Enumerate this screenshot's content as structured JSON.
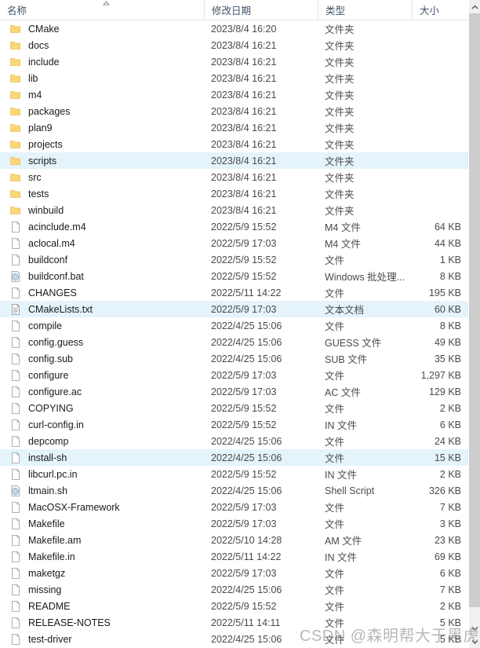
{
  "window": {
    "accent_selection_color": "#e5f3fb",
    "header_text_color": "#40556b"
  },
  "columns": {
    "name": "名称",
    "date_modified": "修改日期",
    "type": "类型",
    "size": "大小",
    "sort_indicator": "ascending"
  },
  "scrollbar": {
    "up_arrow": "^",
    "down_arrow": "v"
  },
  "watermark": {
    "text": "CSDN @森明帮大于黑虎帮"
  },
  "files": [
    {
      "name": "CMake",
      "date": "2023/8/4 16:20",
      "type": "文件夹",
      "size": "",
      "icon": "folder-icon",
      "selected": false
    },
    {
      "name": "docs",
      "date": "2023/8/4 16:21",
      "type": "文件夹",
      "size": "",
      "icon": "folder-icon",
      "selected": false
    },
    {
      "name": "include",
      "date": "2023/8/4 16:21",
      "type": "文件夹",
      "size": "",
      "icon": "folder-icon",
      "selected": false
    },
    {
      "name": "lib",
      "date": "2023/8/4 16:21",
      "type": "文件夹",
      "size": "",
      "icon": "folder-icon",
      "selected": false
    },
    {
      "name": "m4",
      "date": "2023/8/4 16:21",
      "type": "文件夹",
      "size": "",
      "icon": "folder-icon",
      "selected": false
    },
    {
      "name": "packages",
      "date": "2023/8/4 16:21",
      "type": "文件夹",
      "size": "",
      "icon": "folder-icon",
      "selected": false
    },
    {
      "name": "plan9",
      "date": "2023/8/4 16:21",
      "type": "文件夹",
      "size": "",
      "icon": "folder-icon",
      "selected": false
    },
    {
      "name": "projects",
      "date": "2023/8/4 16:21",
      "type": "文件夹",
      "size": "",
      "icon": "folder-icon",
      "selected": false
    },
    {
      "name": "scripts",
      "date": "2023/8/4 16:21",
      "type": "文件夹",
      "size": "",
      "icon": "folder-icon",
      "selected": true
    },
    {
      "name": "src",
      "date": "2023/8/4 16:21",
      "type": "文件夹",
      "size": "",
      "icon": "folder-icon",
      "selected": false
    },
    {
      "name": "tests",
      "date": "2023/8/4 16:21",
      "type": "文件夹",
      "size": "",
      "icon": "folder-icon",
      "selected": false
    },
    {
      "name": "winbuild",
      "date": "2023/8/4 16:21",
      "type": "文件夹",
      "size": "",
      "icon": "folder-icon",
      "selected": false
    },
    {
      "name": "acinclude.m4",
      "date": "2022/5/9 15:52",
      "type": "M4 文件",
      "size": "64 KB",
      "icon": "file-icon",
      "selected": false
    },
    {
      "name": "aclocal.m4",
      "date": "2022/5/9 17:03",
      "type": "M4 文件",
      "size": "44 KB",
      "icon": "file-icon",
      "selected": false
    },
    {
      "name": "buildconf",
      "date": "2022/5/9 15:52",
      "type": "文件",
      "size": "1 KB",
      "icon": "file-icon",
      "selected": false
    },
    {
      "name": "buildconf.bat",
      "date": "2022/5/9 15:52",
      "type": "Windows 批处理...",
      "size": "8 KB",
      "icon": "gear-file-icon",
      "selected": false
    },
    {
      "name": "CHANGES",
      "date": "2022/5/11 14:22",
      "type": "文件",
      "size": "195 KB",
      "icon": "file-icon",
      "selected": false
    },
    {
      "name": "CMakeLists.txt",
      "date": "2022/5/9 17:03",
      "type": "文本文档",
      "size": "60 KB",
      "icon": "text-file-icon",
      "selected": true
    },
    {
      "name": "compile",
      "date": "2022/4/25 15:06",
      "type": "文件",
      "size": "8 KB",
      "icon": "file-icon",
      "selected": false
    },
    {
      "name": "config.guess",
      "date": "2022/4/25 15:06",
      "type": "GUESS 文件",
      "size": "49 KB",
      "icon": "file-icon",
      "selected": false
    },
    {
      "name": "config.sub",
      "date": "2022/4/25 15:06",
      "type": "SUB 文件",
      "size": "35 KB",
      "icon": "file-icon",
      "selected": false
    },
    {
      "name": "configure",
      "date": "2022/5/9 17:03",
      "type": "文件",
      "size": "1,297 KB",
      "icon": "file-icon",
      "selected": false
    },
    {
      "name": "configure.ac",
      "date": "2022/5/9 17:03",
      "type": "AC 文件",
      "size": "129 KB",
      "icon": "file-icon",
      "selected": false
    },
    {
      "name": "COPYING",
      "date": "2022/5/9 15:52",
      "type": "文件",
      "size": "2 KB",
      "icon": "file-icon",
      "selected": false
    },
    {
      "name": "curl-config.in",
      "date": "2022/5/9 15:52",
      "type": "IN 文件",
      "size": "6 KB",
      "icon": "file-icon",
      "selected": false
    },
    {
      "name": "depcomp",
      "date": "2022/4/25 15:06",
      "type": "文件",
      "size": "24 KB",
      "icon": "file-icon",
      "selected": false
    },
    {
      "name": "install-sh",
      "date": "2022/4/25 15:06",
      "type": "文件",
      "size": "15 KB",
      "icon": "file-icon",
      "selected": true
    },
    {
      "name": "libcurl.pc.in",
      "date": "2022/5/9 15:52",
      "type": "IN 文件",
      "size": "2 KB",
      "icon": "file-icon",
      "selected": false
    },
    {
      "name": "ltmain.sh",
      "date": "2022/4/25 15:06",
      "type": "Shell Script",
      "size": "326 KB",
      "icon": "gear-file-icon",
      "selected": false
    },
    {
      "name": "MacOSX-Framework",
      "date": "2022/5/9 17:03",
      "type": "文件",
      "size": "7 KB",
      "icon": "file-icon",
      "selected": false
    },
    {
      "name": "Makefile",
      "date": "2022/5/9 17:03",
      "type": "文件",
      "size": "3 KB",
      "icon": "file-icon",
      "selected": false
    },
    {
      "name": "Makefile.am",
      "date": "2022/5/10 14:28",
      "type": "AM 文件",
      "size": "23 KB",
      "icon": "file-icon",
      "selected": false
    },
    {
      "name": "Makefile.in",
      "date": "2022/5/11 14:22",
      "type": "IN 文件",
      "size": "69 KB",
      "icon": "file-icon",
      "selected": false
    },
    {
      "name": "maketgz",
      "date": "2022/5/9 17:03",
      "type": "文件",
      "size": "6 KB",
      "icon": "file-icon",
      "selected": false
    },
    {
      "name": "missing",
      "date": "2022/4/25 15:06",
      "type": "文件",
      "size": "7 KB",
      "icon": "file-icon",
      "selected": false
    },
    {
      "name": "README",
      "date": "2022/5/9 15:52",
      "type": "文件",
      "size": "2 KB",
      "icon": "file-icon",
      "selected": false
    },
    {
      "name": "RELEASE-NOTES",
      "date": "2022/5/11 14:11",
      "type": "文件",
      "size": "5 KB",
      "icon": "file-icon",
      "selected": false
    },
    {
      "name": "test-driver",
      "date": "2022/4/25 15:06",
      "type": "文件",
      "size": "5 KB",
      "icon": "file-icon",
      "selected": false
    }
  ]
}
